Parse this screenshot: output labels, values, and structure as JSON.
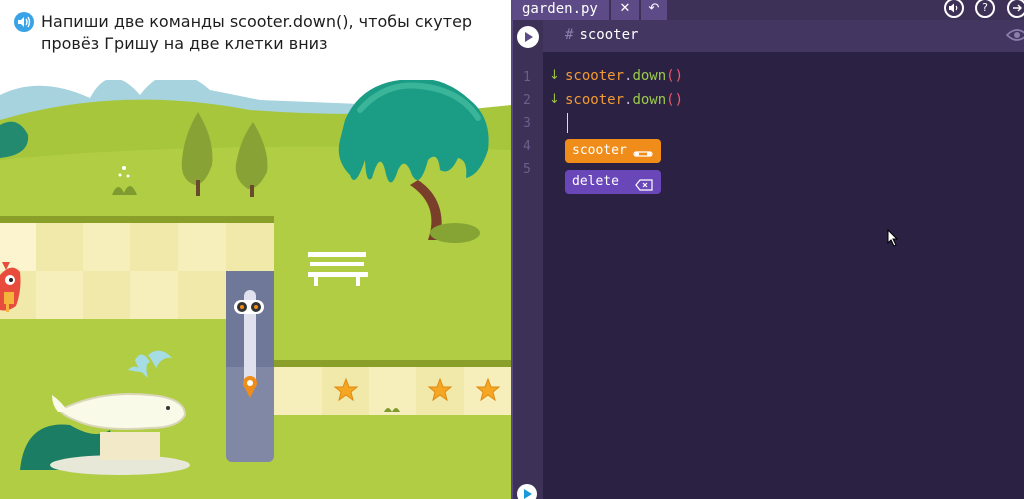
{
  "task": {
    "text": "Напиши две команды scooter.down(), чтобы скутер провёз Гришу на две клетки вниз",
    "icon": "speaker-icon",
    "icon_color": "#3aa3e8"
  },
  "editor": {
    "tab_filename": "garden.py",
    "tab_close": "✕",
    "tab_undo": "↶",
    "file_comment": "#",
    "file_title": "scooter",
    "line_numbers": [
      "1",
      "2",
      "3",
      "4",
      "5"
    ],
    "lines": [
      {
        "obj": "scooter",
        "dot": ".",
        "fn": "down",
        "par": "()"
      },
      {
        "obj": "scooter",
        "dot": ".",
        "fn": "down",
        "par": "()"
      }
    ],
    "line_marker": "↓",
    "suggestions": [
      {
        "label": "scooter",
        "icon": "scooter-chip-icon",
        "color": "#f08d1a"
      },
      {
        "label": "delete",
        "icon": "backspace-icon",
        "color": "#6a47b8"
      }
    ],
    "top_icons": {
      "sound": "volume-icon",
      "help": "?",
      "exit": "exit-icon"
    },
    "colors": {
      "background": "#2b2142",
      "gutter": "#3d3157",
      "code_obj": "#f39b32",
      "code_fn": "#9ccb4a",
      "code_paren": "#e95a6a"
    }
  },
  "game": {
    "star_count": 3,
    "colors": {
      "sky": "#ffffff",
      "grass": "#a7c63c",
      "tile_light": "#fbf4c8",
      "tile_dark": "#f1e9aa",
      "track": "#8088a6",
      "tree": "#1b9c84"
    }
  }
}
